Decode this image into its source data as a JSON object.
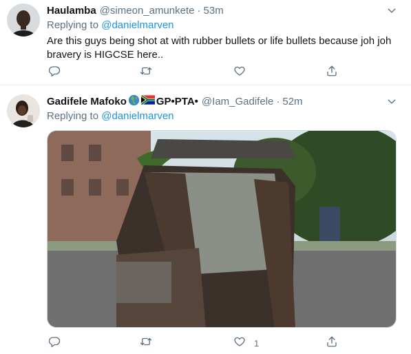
{
  "tweets": [
    {
      "author_name": "Haulamba",
      "handle": "@simeon_amunkete",
      "separator": "·",
      "time": "53m",
      "replying_prefix": "Replying to",
      "replying_to": "@danielmarven",
      "text": "Are this guys being shot at with rubber bullets or life bullets because joh joh bravery is HIGCSE here..",
      "actions": {
        "reply_icon": "reply-icon",
        "retweet_icon": "retweet-icon",
        "like_icon": "heart-icon",
        "share_icon": "share-icon"
      }
    },
    {
      "author_name": "Gadifele Mafoko",
      "name_emojis": [
        "globe-africa-emoji",
        "south-africa-flag-emoji"
      ],
      "name_suffix": "GP•PTA•",
      "handle": "@Iam_Gadifele",
      "separator": "·",
      "time": "52m",
      "replying_prefix": "Replying to",
      "replying_to": "@danielmarven",
      "media": "photo of a burnt-out vehicle",
      "actions": {
        "reply_icon": "reply-icon",
        "retweet_icon": "retweet-icon",
        "like_icon": "heart-icon",
        "like_count": "1",
        "share_icon": "share-icon"
      }
    }
  ],
  "colors": {
    "text": "#0f1419",
    "secondary": "#5b7083",
    "link": "#1b95e0",
    "divider": "#e6ecf0"
  }
}
